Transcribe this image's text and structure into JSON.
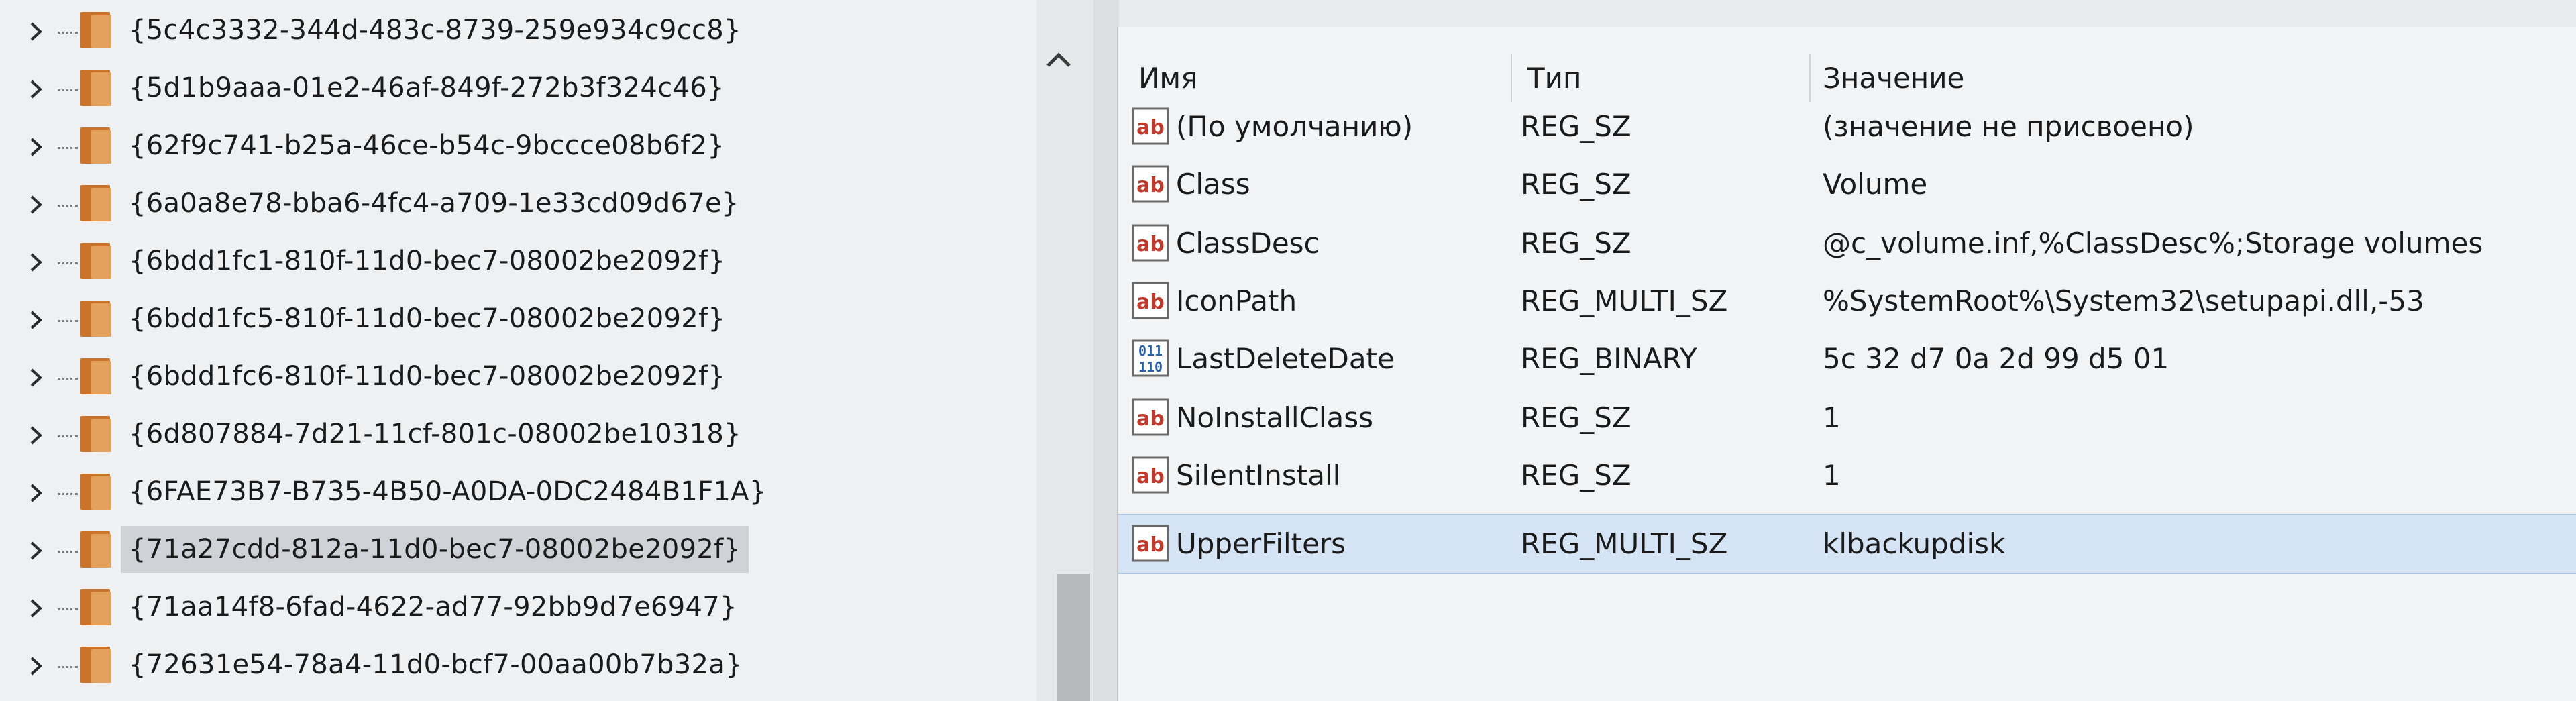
{
  "tree": {
    "items": [
      {
        "label": "{5c4c3332-344d-483c-8739-259e934c9cc8}",
        "selected": false
      },
      {
        "label": "{5d1b9aaa-01e2-46af-849f-272b3f324c46}",
        "selected": false
      },
      {
        "label": "{62f9c741-b25a-46ce-b54c-9bccce08b6f2}",
        "selected": false
      },
      {
        "label": "{6a0a8e78-bba6-4fc4-a709-1e33cd09d67e}",
        "selected": false
      },
      {
        "label": "{6bdd1fc1-810f-11d0-bec7-08002be2092f}",
        "selected": false
      },
      {
        "label": "{6bdd1fc5-810f-11d0-bec7-08002be2092f}",
        "selected": false
      },
      {
        "label": "{6bdd1fc6-810f-11d0-bec7-08002be2092f}",
        "selected": false
      },
      {
        "label": "{6d807884-7d21-11cf-801c-08002be10318}",
        "selected": false
      },
      {
        "label": "{6FAE73B7-B735-4B50-A0DA-0DC2484B1F1A}",
        "selected": false
      },
      {
        "label": "{71a27cdd-812a-11d0-bec7-08002be2092f}",
        "selected": true
      },
      {
        "label": "{71aa14f8-6fad-4622-ad77-92bb9d7e6947}",
        "selected": false
      },
      {
        "label": "{72631e54-78a4-11d0-bcf7-00aa00b7b32a}",
        "selected": false
      }
    ]
  },
  "values": {
    "columns": {
      "name": "Имя",
      "type": "Тип",
      "data": "Значение"
    },
    "rows": [
      {
        "name": "(По умолчанию)",
        "type": "REG_SZ",
        "data": "(значение не присвоено)",
        "icon": "string-value-icon"
      },
      {
        "name": "Class",
        "type": "REG_SZ",
        "data": "Volume",
        "icon": "string-value-icon"
      },
      {
        "name": "ClassDesc",
        "type": "REG_SZ",
        "data": "@c_volume.inf,%ClassDesc%;Storage volumes",
        "icon": "string-value-icon"
      },
      {
        "name": "IconPath",
        "type": "REG_MULTI_SZ",
        "data": "%SystemRoot%\\System32\\setupapi.dll,-53",
        "icon": "string-value-icon"
      },
      {
        "name": "LastDeleteDate",
        "type": "REG_BINARY",
        "data": "5c 32 d7 0a 2d 99 d5 01",
        "icon": "binary-value-icon"
      },
      {
        "name": "NoInstallClass",
        "type": "REG_SZ",
        "data": "1",
        "icon": "string-value-icon"
      },
      {
        "name": "SilentInstall",
        "type": "REG_SZ",
        "data": "1",
        "icon": "string-value-icon"
      },
      {
        "name": "UpperFilters",
        "type": "REG_MULTI_SZ",
        "data": "klbackupdisk",
        "icon": "string-value-icon",
        "selected": true
      }
    ]
  },
  "colors": {
    "folder_dark": "#c9742a",
    "folder_light": "#e3a15b",
    "string_icon_red": "#c0392b",
    "binary_icon_blue": "#2b5fa8",
    "selection_blue": "#d5e4f5"
  }
}
